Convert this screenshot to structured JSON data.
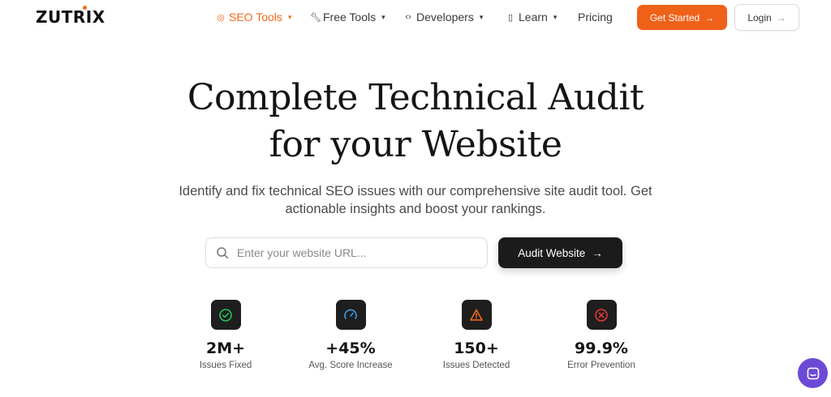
{
  "brand": {
    "logo_text": "ZUTRIX",
    "accent_color": "#ef6119"
  },
  "nav": {
    "items": [
      {
        "label": "SEO Tools",
        "icon": "target-icon",
        "has_dropdown": true,
        "active": true
      },
      {
        "label": "Free Tools",
        "icon": "wrench-icon",
        "has_dropdown": true,
        "active": false
      },
      {
        "label": "Developers",
        "icon": "code-icon",
        "has_dropdown": true,
        "active": false
      },
      {
        "label": "Learn",
        "icon": "book-icon",
        "has_dropdown": true,
        "active": false
      },
      {
        "label": "Pricing",
        "icon": "",
        "has_dropdown": false,
        "active": false
      }
    ],
    "get_started_label": "Get Started",
    "login_label": "Login"
  },
  "hero": {
    "title_line1": "Complete Technical Audit",
    "title_line2": "for your Website",
    "subtitle_line1": "Identify and fix technical SEO issues with our comprehensive site audit tool. Get",
    "subtitle_line2": "actionable insights and boost your rankings.",
    "search_placeholder": "Enter your website URL...",
    "search_value": "",
    "audit_button_label": "Audit Website"
  },
  "stats": [
    {
      "value": "2M+",
      "label": "Issues Fixed",
      "icon": "check-circle-icon",
      "color": "#22c55e"
    },
    {
      "value": "+45%",
      "label": "Avg. Score Increase",
      "icon": "gauge-icon",
      "color": "#3b9ae1"
    },
    {
      "value": "150+",
      "label": "Issues Detected",
      "icon": "warning-triangle-icon",
      "color": "#f26b1d"
    },
    {
      "value": "99.9%",
      "label": "Error Prevention",
      "icon": "x-circle-icon",
      "color": "#e53935"
    }
  ],
  "chat_widget": {
    "icon": "chat-icon",
    "color": "#6c4ad6"
  }
}
